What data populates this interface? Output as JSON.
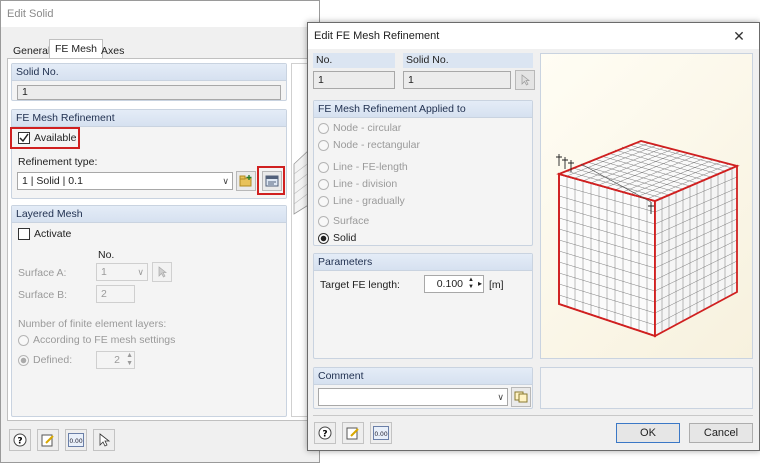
{
  "edit_solid": {
    "title": "Edit Solid",
    "tabs": [
      "General",
      "FE Mesh",
      "Axes"
    ],
    "solid_no_header": "Solid No.",
    "solid_no_value": "1",
    "fe_mesh_header": "FE Mesh Refinement",
    "available_label": "Available",
    "refinement_type_label": "Refinement type:",
    "refinement_type_value": "1  |  Solid  |  0.1",
    "layered_header": "Layered Mesh",
    "activate_label": "Activate",
    "no_label": "No.",
    "surface_a_label": "Surface A:",
    "surface_a_value": "1",
    "surface_b_label": "Surface B:",
    "surface_b_value": "2",
    "layers_label": "Number of finite element layers:",
    "according_label": "According to FE mesh settings",
    "defined_label": "Defined:",
    "defined_value": "2"
  },
  "refinement": {
    "title": "Edit FE Mesh Refinement",
    "no_label": "No.",
    "no_value": "1",
    "solid_no_label": "Solid No.",
    "solid_no_value": "1",
    "applied_header": "FE Mesh Refinement Applied to",
    "options": [
      "Node - circular",
      "Node - rectangular",
      "Line - FE-length",
      "Line - division",
      "Line - gradually",
      "Surface",
      "Solid"
    ],
    "params_header": "Parameters",
    "target_label": "Target FE length:",
    "target_value": "0.100",
    "target_unit": "[m]",
    "comment_header": "Comment",
    "comment_value": "",
    "ok_label": "OK",
    "cancel_label": "Cancel"
  }
}
